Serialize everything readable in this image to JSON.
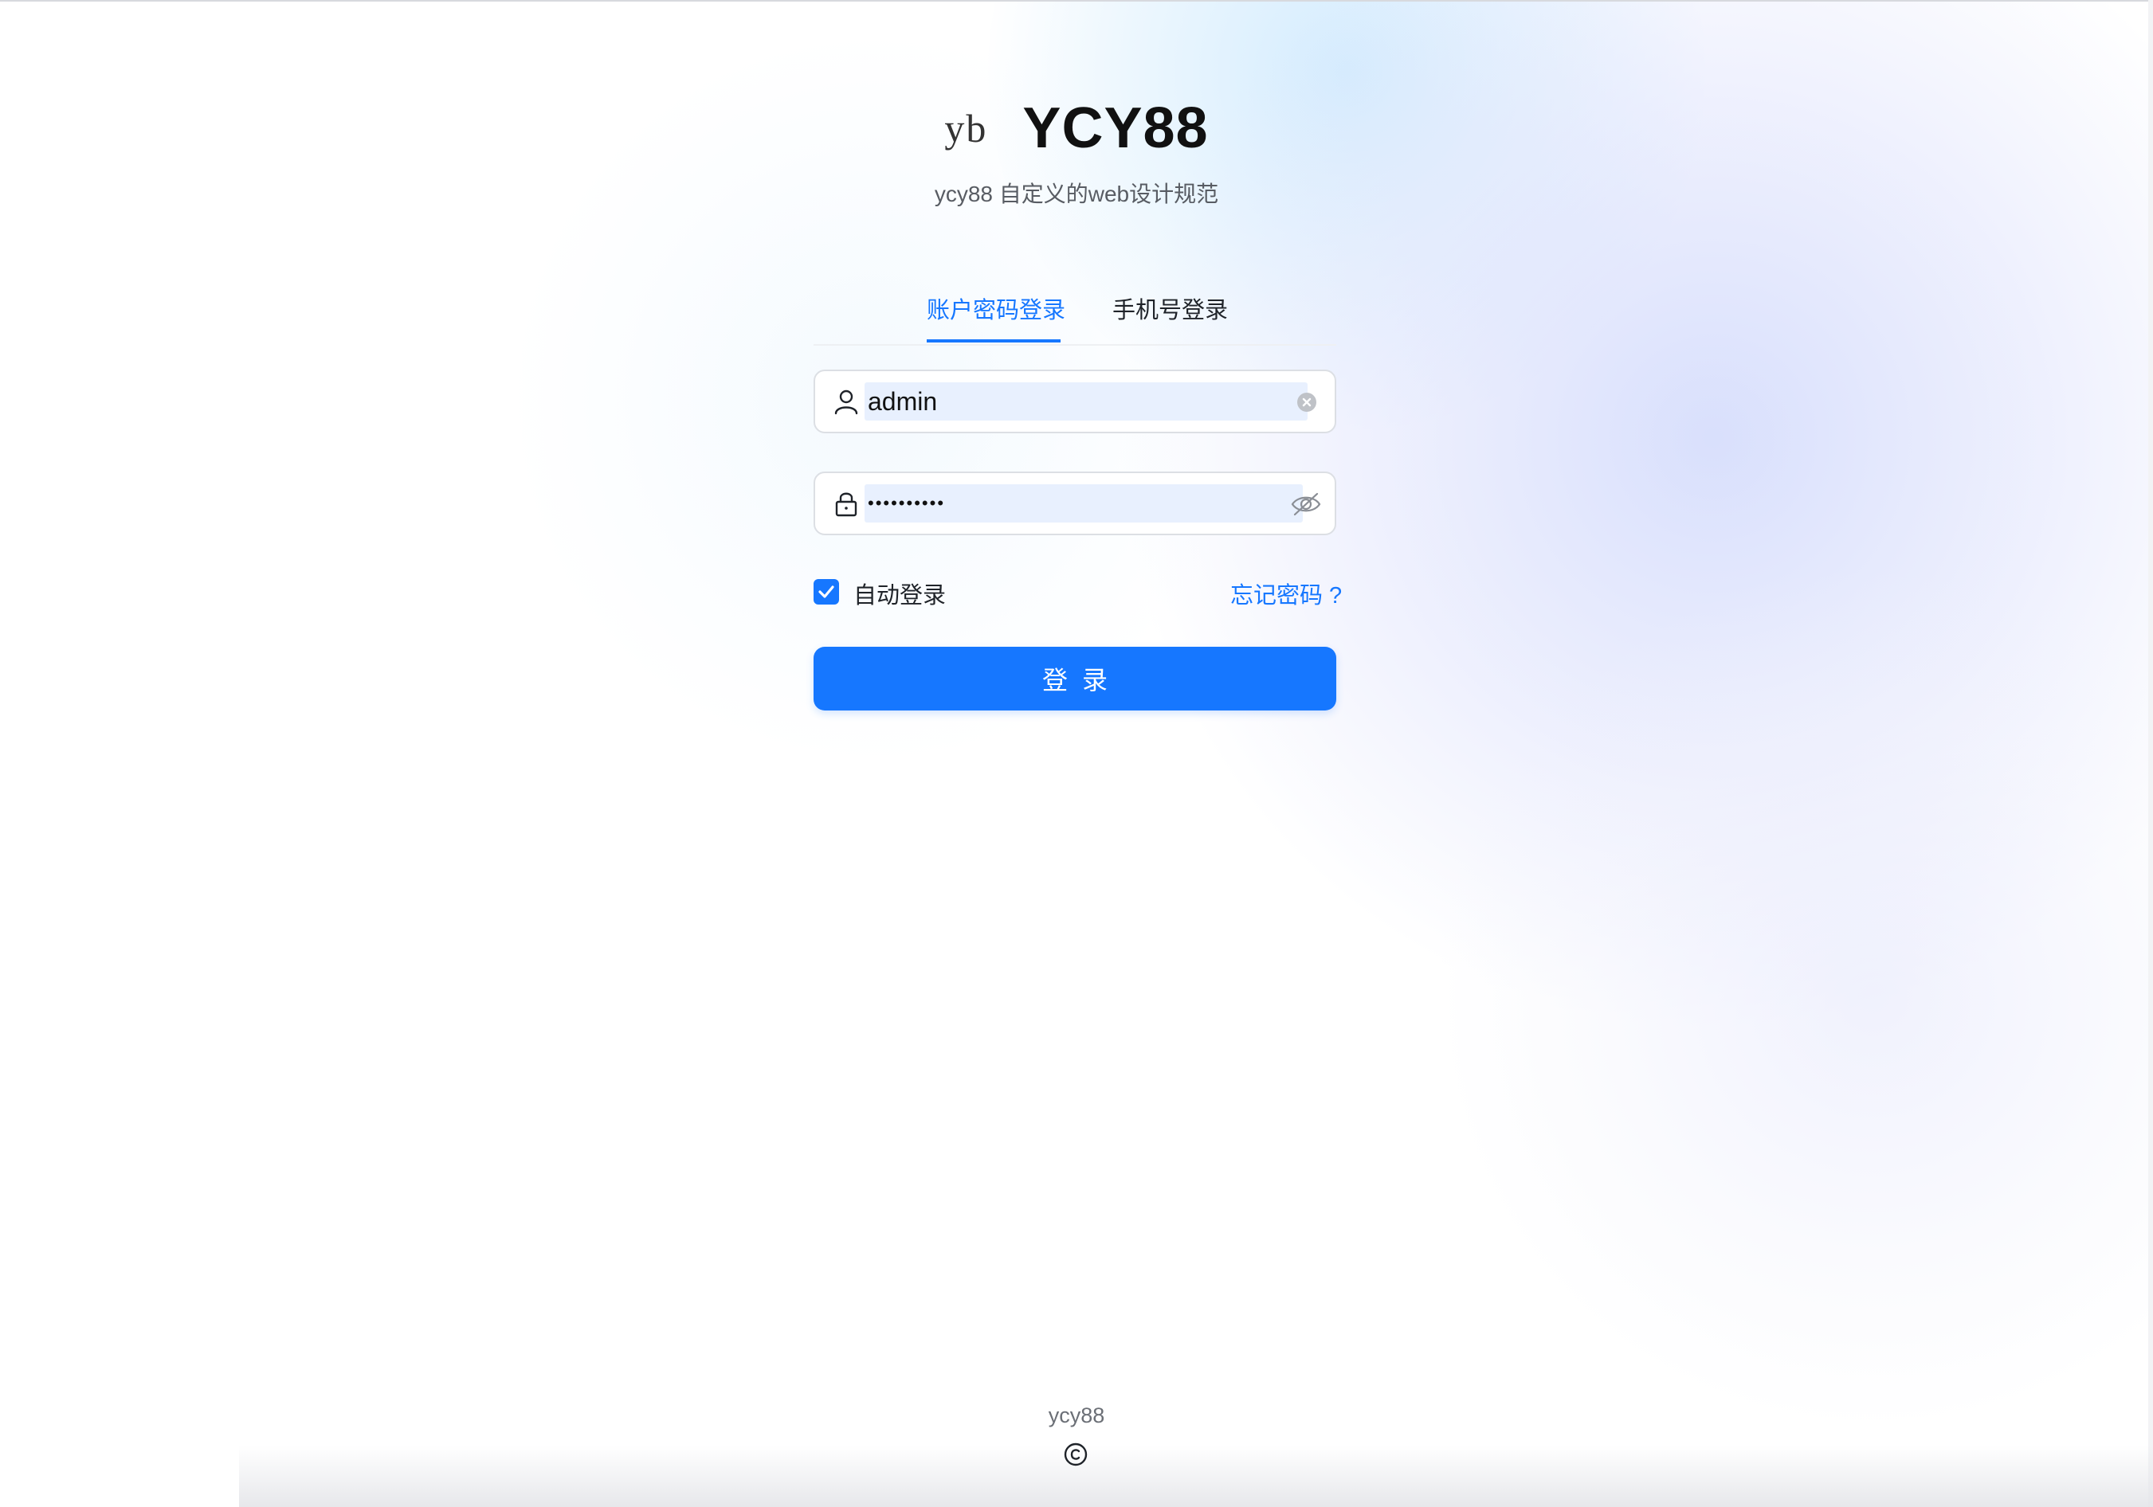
{
  "brand": {
    "logo_text": "yb",
    "title": "YCY88",
    "subtitle": "ycy88 自定义的web设计规范"
  },
  "tabs": [
    {
      "label": "账户密码登录",
      "active": true
    },
    {
      "label": "手机号登录",
      "active": false
    }
  ],
  "form": {
    "username": {
      "value": "admin",
      "prefix_icon": "user-icon",
      "suffix_icon": "clear-icon"
    },
    "password": {
      "masked_value": "••••••••••",
      "prefix_icon": "lock-icon",
      "suffix_icon": "eye-invisible-icon"
    },
    "auto_login": {
      "label": "自动登录",
      "checked": true
    },
    "forgot_password": "忘记密码 ?",
    "submit_label": "登录"
  },
  "footer": {
    "text": "ycy88",
    "copyright_icon": "copyright-icon"
  },
  "colors": {
    "primary": "#1677ff",
    "text": "#1f2329",
    "muted": "#585c63",
    "border": "#dcdfe4",
    "autofill": "#e8f0fe"
  }
}
